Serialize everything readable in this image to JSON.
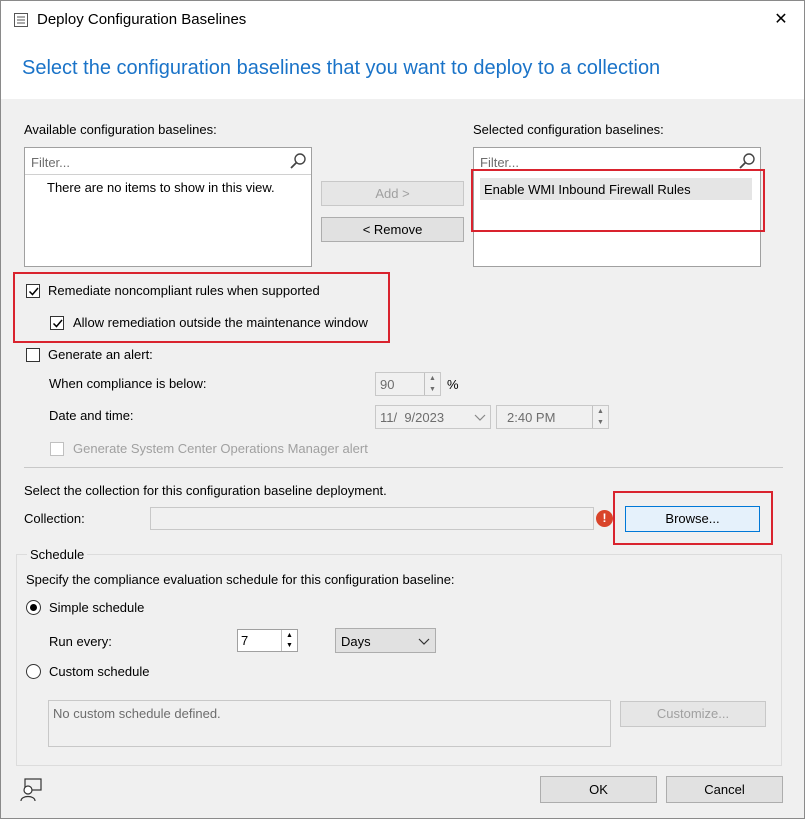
{
  "window": {
    "title": "Deploy Configuration Baselines",
    "close_glyph": "✕"
  },
  "header": {
    "text": "Select the configuration baselines that you want to deploy to a collection"
  },
  "available": {
    "label": "Available configuration baselines:",
    "filter_placeholder": "Filter...",
    "empty_text": "There are no items to show in this view."
  },
  "buttons": {
    "add": "Add >",
    "remove": "< Remove",
    "browse": "Browse...",
    "customize": "Customize...",
    "ok": "OK",
    "cancel": "Cancel"
  },
  "selected": {
    "label": "Selected configuration baselines:",
    "filter_placeholder": "Filter...",
    "items": [
      "Enable WMI Inbound Firewall Rules"
    ]
  },
  "remediate": {
    "label": "Remediate noncompliant rules when supported",
    "checked": true,
    "allow_outside_label": "Allow remediation outside the maintenance window",
    "allow_outside_checked": true
  },
  "alert": {
    "label": "Generate an alert:",
    "checked": false,
    "compliance_label": "When compliance is below:",
    "compliance_value": "90",
    "percent": "%",
    "datetime_label": "Date and time:",
    "date_value": "11/  9/2023",
    "time_value": "2:40 PM",
    "scom_label": "Generate System Center Operations Manager alert"
  },
  "collection": {
    "instruction": "Select the collection for this configuration baseline deployment.",
    "label": "Collection:",
    "value": "",
    "error_glyph": "!"
  },
  "schedule": {
    "group_label": "Schedule",
    "instruction": "Specify the compliance evaluation schedule for this configuration baseline:",
    "simple_label": "Simple schedule",
    "run_every_label": "Run every:",
    "run_every_value": "7",
    "unit_value": "Days",
    "custom_label": "Custom schedule",
    "custom_text": "No custom schedule defined."
  },
  "colors": {
    "accent": "#1a73c8",
    "highlight": "#d9232e"
  }
}
